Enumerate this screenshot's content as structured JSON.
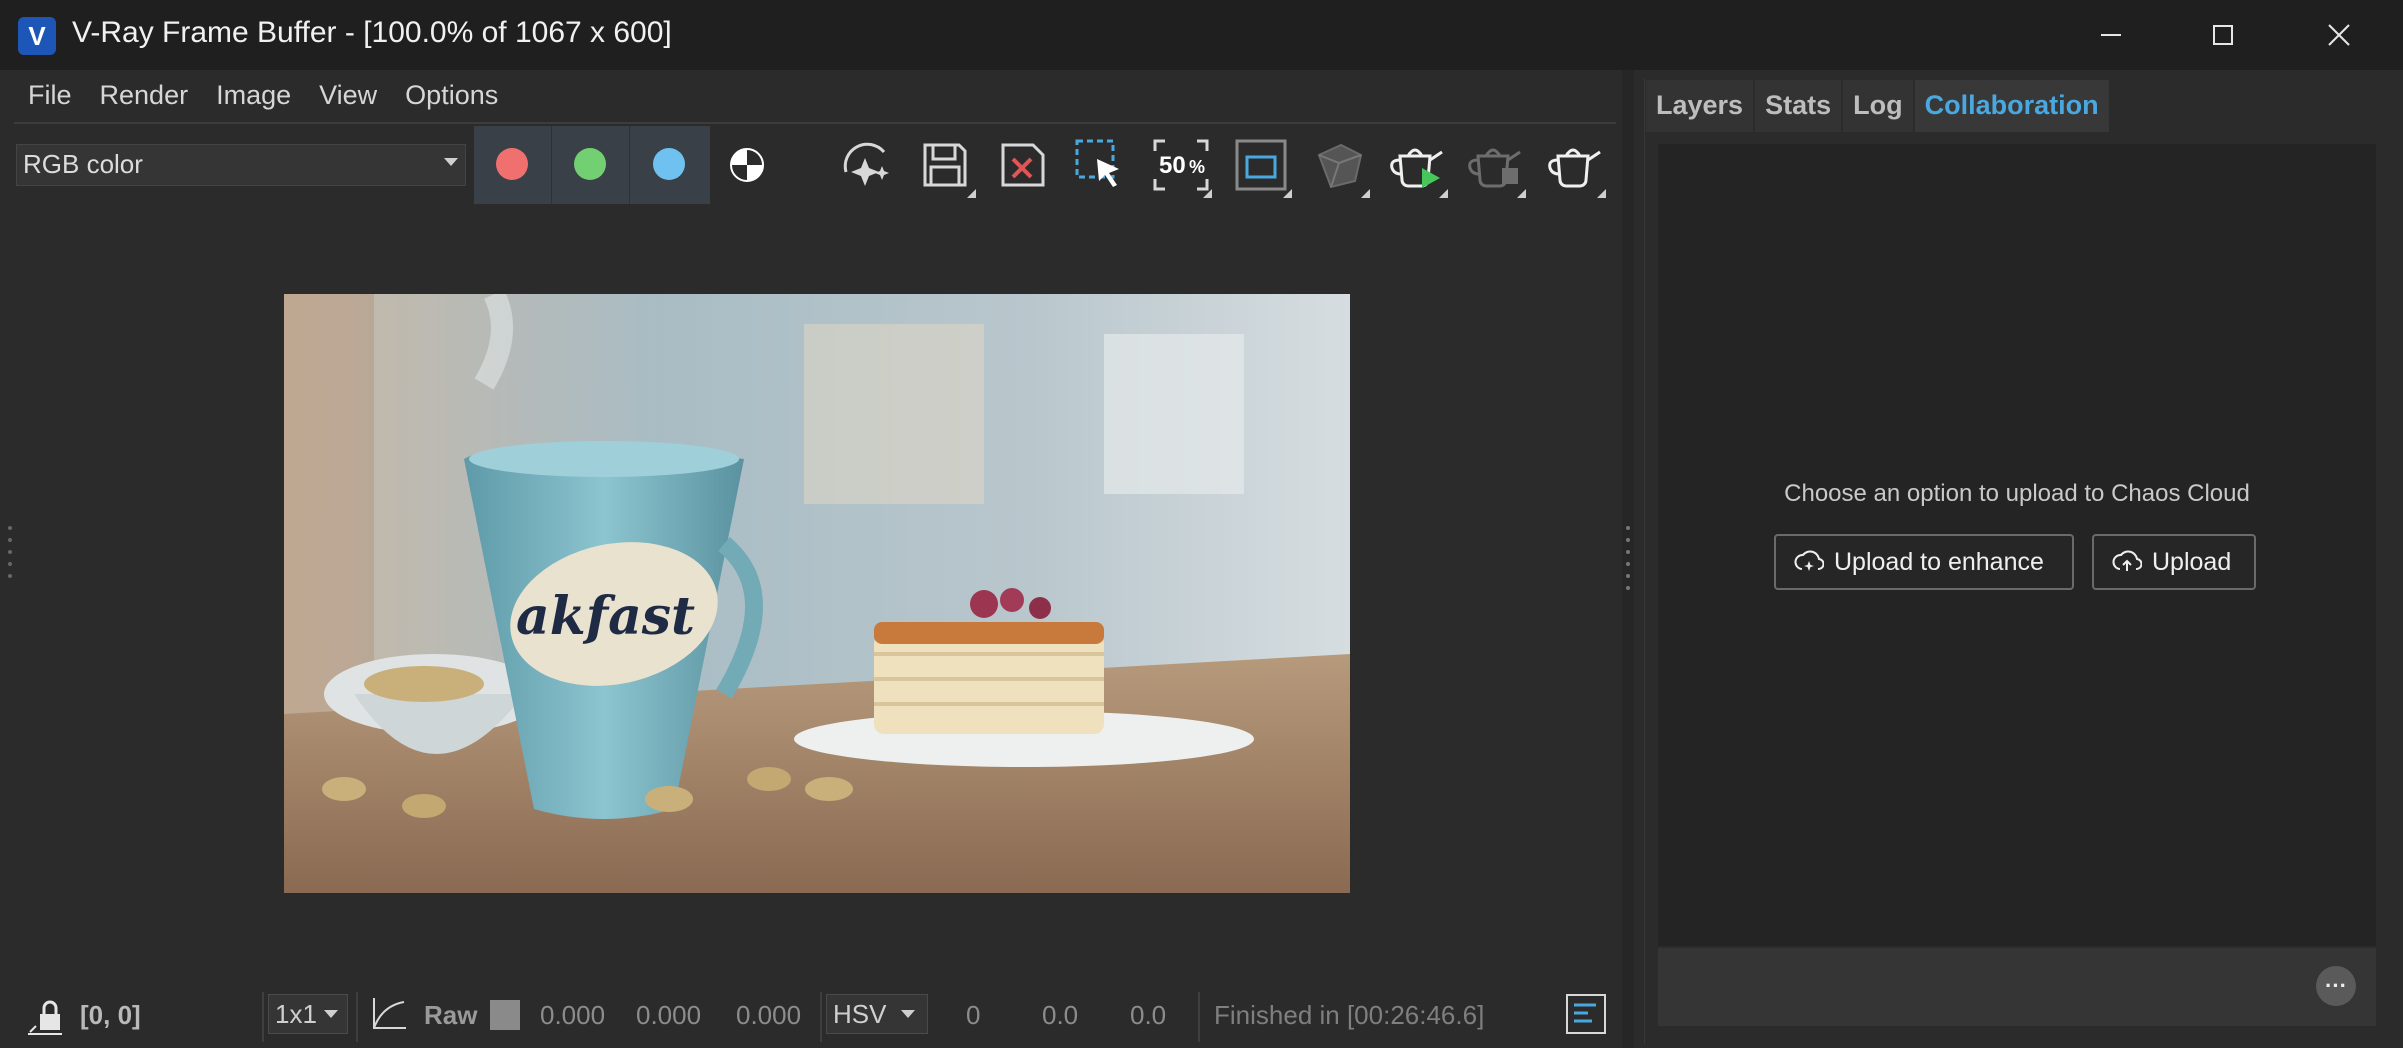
{
  "window": {
    "title": "V-Ray Frame Buffer - [100.0% of 1067 x 600]",
    "logo_letter": "V"
  },
  "menu": {
    "items": [
      "File",
      "Render",
      "Image",
      "View",
      "Options"
    ]
  },
  "toolbar": {
    "channel_value": "RGB color",
    "zoom_label": "50",
    "colors": {
      "red": "#f07070",
      "green": "#72d072",
      "blue": "#6fc2f0",
      "accent_blue": "#4aa8e0"
    },
    "icons": [
      "denoise-icon",
      "save-icon",
      "clear-icon",
      "region-select-icon",
      "zoom-50-icon",
      "region-render-icon",
      "track-mouse-icon",
      "render-interactive-icon",
      "stop-render-icon",
      "render-icon"
    ]
  },
  "right_panel": {
    "tabs": [
      "Layers",
      "Stats",
      "Log",
      "Collaboration"
    ],
    "active_tab": "Collaboration",
    "message": "Choose an option to upload to Chaos Cloud",
    "upload_enhance_label": "Upload to enhance",
    "upload_label": "Upload",
    "more_label": "···"
  },
  "status": {
    "coords": "[0, 0]",
    "sample_size": "1x1",
    "raw_label": "Raw",
    "rgb_values": [
      "0.000",
      "0.000",
      "0.000"
    ],
    "color_mode": "HSV",
    "hsv_values": [
      "0",
      "0.0",
      "0.0"
    ],
    "finished": "Finished in [00:26:46.6]"
  }
}
